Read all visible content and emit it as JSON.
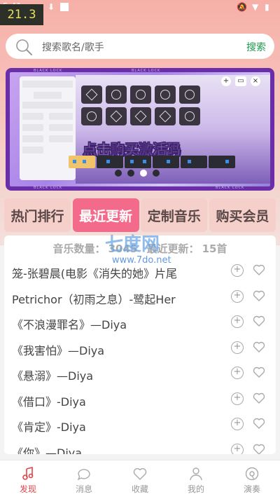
{
  "status_bar": {
    "time": "5:41",
    "fps_overlay": "21.3"
  },
  "search": {
    "placeholder": "搜索歌名/歌手",
    "button_label": "搜索"
  },
  "banner": {
    "headline": "点击购买激活码",
    "strip_text": "BLACK LOCK",
    "carousel_count": 4,
    "carousel_active": 2
  },
  "tabs": [
    {
      "label": "热门排行",
      "active": false
    },
    {
      "label": "最近更新",
      "active": true
    },
    {
      "label": "定制音乐",
      "active": false
    },
    {
      "label": "购买会员",
      "active": false
    }
  ],
  "summary": {
    "count_label": "音乐数量：",
    "count_value": "3045",
    "update_label": "最近更新：",
    "update_value": "15首"
  },
  "songs": [
    {
      "title": "笼-张碧晨(电影《消失的她》片尾"
    },
    {
      "title": "Petrichor（初雨之息）-鹭起Her"
    },
    {
      "title": "《不浪漫罪名》—Diya"
    },
    {
      "title": "《我害怕》—Diya"
    },
    {
      "title": "《悬溺》—Diya"
    },
    {
      "title": "《借口》-Diya"
    },
    {
      "title": "《肯定》-Diya"
    },
    {
      "title": "《你》—Diya"
    }
  ],
  "watermark": {
    "main": "七度网",
    "url": "www.7do.net"
  },
  "bottom_nav": [
    {
      "label": "发现",
      "icon": "music-note-icon",
      "active": true
    },
    {
      "label": "消息",
      "icon": "chat-bubble-icon",
      "active": false
    },
    {
      "label": "收藏",
      "icon": "heart-icon",
      "active": false
    },
    {
      "label": "我的",
      "icon": "user-icon",
      "active": false
    },
    {
      "label": "演奏",
      "icon": "disc-icon",
      "active": false
    }
  ],
  "colors": {
    "accent": "#f46a8a",
    "search_button": "#1a9b4a",
    "nav_active": "#e0454a"
  }
}
